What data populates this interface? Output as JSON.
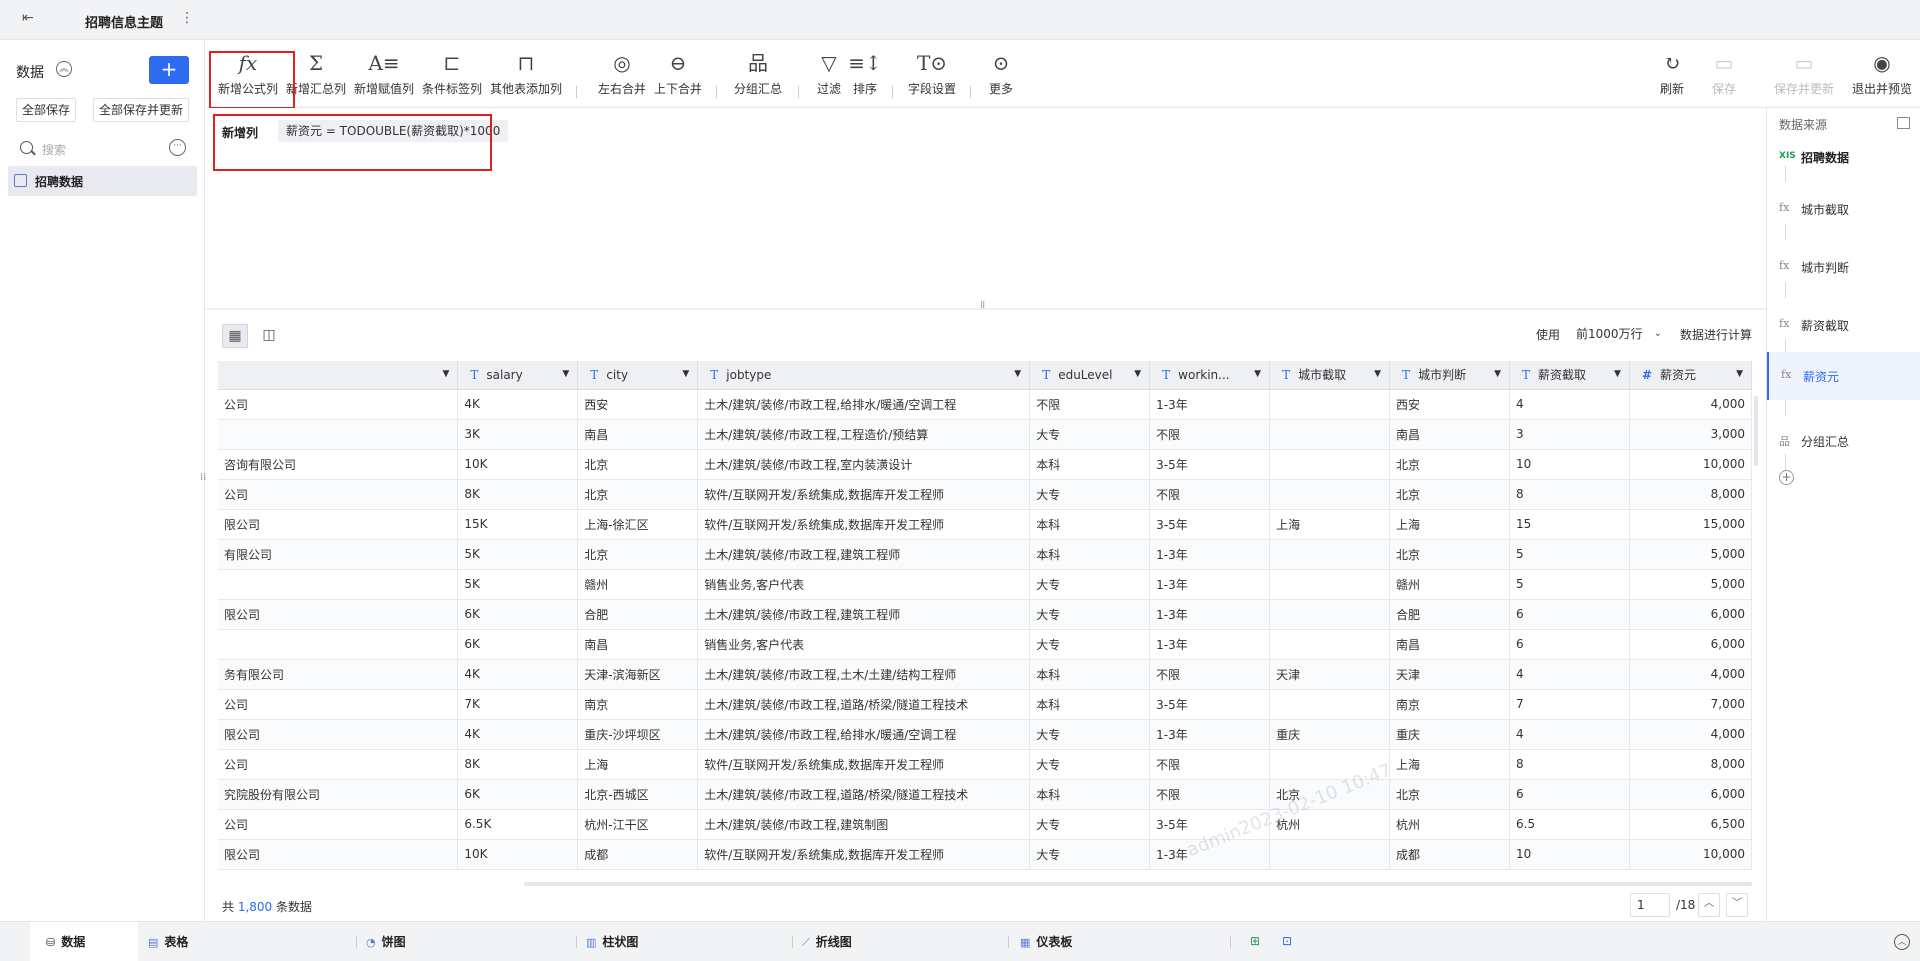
{
  "app": {
    "title": "招聘信息主题"
  },
  "left_panel": {
    "title": "数据",
    "save_all": "全部保存",
    "save_all_update": "全部保存并更新",
    "search_placeholder": "搜索",
    "items": [
      {
        "label": "招聘数据"
      }
    ]
  },
  "toolbar": {
    "items": [
      {
        "icon": "fx-icon",
        "label": "新增公式列"
      },
      {
        "icon": "sigma-icon",
        "label": "新增汇总列"
      },
      {
        "icon": "assign-icon",
        "label": "新增赋值列"
      },
      {
        "icon": "tag-icon",
        "label": "条件标签列"
      },
      {
        "icon": "add-column-icon",
        "label": "其他表添加列"
      },
      {
        "icon": "merge-lr-icon",
        "label": "左右合并"
      },
      {
        "icon": "merge-ud-icon",
        "label": "上下合并"
      },
      {
        "icon": "group-icon",
        "label": "分组汇总"
      },
      {
        "icon": "filter-icon",
        "label": "过滤"
      },
      {
        "icon": "sort-icon",
        "label": "排序"
      },
      {
        "icon": "field-settings-icon",
        "label": "字段设置"
      },
      {
        "icon": "more-icon",
        "label": "更多"
      }
    ],
    "right_items": [
      {
        "icon": "refresh-icon",
        "label": "刷新"
      },
      {
        "icon": "save-icon",
        "label": "保存"
      },
      {
        "icon": "save-update-icon",
        "label": "保存并更新"
      },
      {
        "icon": "exit-preview-icon",
        "label": "退出并预览"
      }
    ]
  },
  "formula": {
    "label": "新增列",
    "expression": "薪资元 = TODOUBLE(薪资截取)*1000"
  },
  "calc_options": {
    "prefix": "使用",
    "selected": "前1000万行",
    "suffix": "数据进行计算"
  },
  "right_panel": {
    "title": "数据来源",
    "nodes": [
      {
        "icon": "XIS",
        "label": "招聘数据",
        "kind": "source"
      },
      {
        "icon": "fx",
        "label": "城市截取",
        "kind": "step"
      },
      {
        "icon": "fx",
        "label": "城市判断",
        "kind": "step"
      },
      {
        "icon": "fx",
        "label": "薪资截取",
        "kind": "step"
      },
      {
        "icon": "fx",
        "label": "薪资元",
        "kind": "active"
      },
      {
        "icon": "group",
        "label": "分组汇总",
        "kind": "step"
      }
    ]
  },
  "table": {
    "columns": [
      {
        "name": "",
        "type": ""
      },
      {
        "name": "salary",
        "type": "T"
      },
      {
        "name": "city",
        "type": "T"
      },
      {
        "name": "jobtype",
        "type": "T"
      },
      {
        "name": "eduLevel",
        "type": "T"
      },
      {
        "name": "workin...",
        "type": "T"
      },
      {
        "name": "城市截取",
        "type": "T"
      },
      {
        "name": "城市判断",
        "type": "T"
      },
      {
        "name": "薪资截取",
        "type": "T"
      },
      {
        "name": "薪资元",
        "type": "#"
      }
    ],
    "rows": [
      [
        "公司",
        "4K",
        "西安",
        "土木/建筑/装修/市政工程,给排水/暖通/空调工程",
        "不限",
        "1-3年",
        "",
        "西安",
        "4",
        "4,000"
      ],
      [
        "",
        "3K",
        "南昌",
        "土木/建筑/装修/市政工程,工程造价/预结算",
        "大专",
        "不限",
        "",
        "南昌",
        "3",
        "3,000"
      ],
      [
        "咨询有限公司",
        "10K",
        "北京",
        "土木/建筑/装修/市政工程,室内装潢设计",
        "本科",
        "3-5年",
        "",
        "北京",
        "10",
        "10,000"
      ],
      [
        "公司",
        "8K",
        "北京",
        "软件/互联网开发/系统集成,数据库开发工程师",
        "大专",
        "不限",
        "",
        "北京",
        "8",
        "8,000"
      ],
      [
        "限公司",
        "15K",
        "上海-徐汇区",
        "软件/互联网开发/系统集成,数据库开发工程师",
        "本科",
        "3-5年",
        "上海",
        "上海",
        "15",
        "15,000"
      ],
      [
        "有限公司",
        "5K",
        "北京",
        "土木/建筑/装修/市政工程,建筑工程师",
        "本科",
        "1-3年",
        "",
        "北京",
        "5",
        "5,000"
      ],
      [
        "",
        "5K",
        "赣州",
        "销售业务,客户代表",
        "大专",
        "1-3年",
        "",
        "赣州",
        "5",
        "5,000"
      ],
      [
        "限公司",
        "6K",
        "合肥",
        "土木/建筑/装修/市政工程,建筑工程师",
        "大专",
        "1-3年",
        "",
        "合肥",
        "6",
        "6,000"
      ],
      [
        "",
        "6K",
        "南昌",
        "销售业务,客户代表",
        "大专",
        "1-3年",
        "",
        "南昌",
        "6",
        "6,000"
      ],
      [
        "务有限公司",
        "4K",
        "天津-滨海新区",
        "土木/建筑/装修/市政工程,土木/土建/结构工程师",
        "本科",
        "不限",
        "天津",
        "天津",
        "4",
        "4,000"
      ],
      [
        "公司",
        "7K",
        "南京",
        "土木/建筑/装修/市政工程,道路/桥梁/隧道工程技术",
        "本科",
        "3-5年",
        "",
        "南京",
        "7",
        "7,000"
      ],
      [
        "限公司",
        "4K",
        "重庆-沙坪坝区",
        "土木/建筑/装修/市政工程,给排水/暖通/空调工程",
        "大专",
        "1-3年",
        "重庆",
        "重庆",
        "4",
        "4,000"
      ],
      [
        "公司",
        "8K",
        "上海",
        "软件/互联网开发/系统集成,数据库开发工程师",
        "大专",
        "不限",
        "",
        "上海",
        "8",
        "8,000"
      ],
      [
        "究院股份有限公司",
        "6K",
        "北京-西城区",
        "土木/建筑/装修/市政工程,道路/桥梁/隧道工程技术",
        "本科",
        "不限",
        "北京",
        "北京",
        "6",
        "6,000"
      ],
      [
        "公司",
        "6.5K",
        "杭州-江干区",
        "土木/建筑/装修/市政工程,建筑制图",
        "大专",
        "3-5年",
        "杭州",
        "杭州",
        "6.5",
        "6,500"
      ],
      [
        "限公司",
        "10K",
        "成都",
        "软件/互联网开发/系统集成,数据库开发工程师",
        "大专",
        "1-3年",
        "",
        "成都",
        "10",
        "10,000"
      ]
    ]
  },
  "footer": {
    "count_prefix": "共 ",
    "count": "1,800",
    "count_suffix": " 条数据",
    "page": "1",
    "total_pages": "/18"
  },
  "watermark": "admin2023-02-10 10:47",
  "bottom_tabs": [
    {
      "label": "数据",
      "icon": "database-icon"
    },
    {
      "label": "表格",
      "icon": "table-icon"
    },
    {
      "label": "饼图",
      "icon": "pie-chart-icon"
    },
    {
      "label": "柱状图",
      "icon": "bar-chart-icon"
    },
    {
      "label": "折线图",
      "icon": "line-chart-icon"
    },
    {
      "label": "仪表板",
      "icon": "dashboard-icon"
    }
  ]
}
